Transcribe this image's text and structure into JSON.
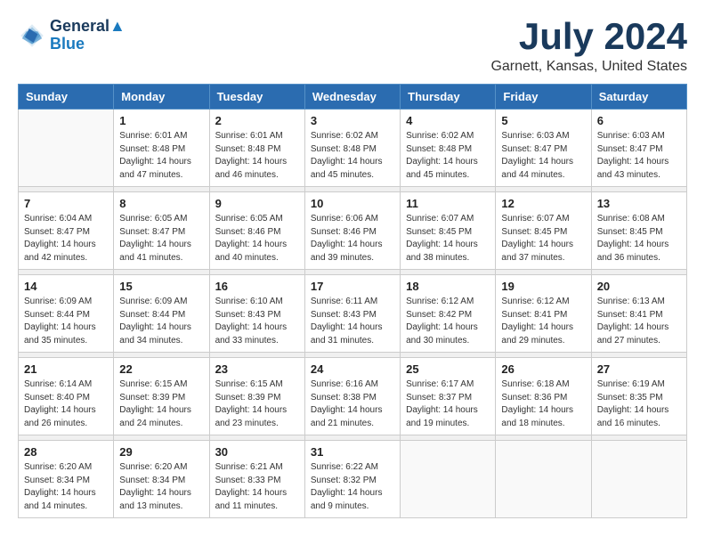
{
  "header": {
    "logo_line1": "General",
    "logo_line2": "Blue",
    "month": "July 2024",
    "location": "Garnett, Kansas, United States"
  },
  "weekdays": [
    "Sunday",
    "Monday",
    "Tuesday",
    "Wednesday",
    "Thursday",
    "Friday",
    "Saturday"
  ],
  "weeks": [
    [
      {
        "day": "",
        "empty": true
      },
      {
        "day": "1",
        "sunrise": "6:01 AM",
        "sunset": "8:48 PM",
        "daylight": "14 hours and 47 minutes."
      },
      {
        "day": "2",
        "sunrise": "6:01 AM",
        "sunset": "8:48 PM",
        "daylight": "14 hours and 46 minutes."
      },
      {
        "day": "3",
        "sunrise": "6:02 AM",
        "sunset": "8:48 PM",
        "daylight": "14 hours and 45 minutes."
      },
      {
        "day": "4",
        "sunrise": "6:02 AM",
        "sunset": "8:48 PM",
        "daylight": "14 hours and 45 minutes."
      },
      {
        "day": "5",
        "sunrise": "6:03 AM",
        "sunset": "8:47 PM",
        "daylight": "14 hours and 44 minutes."
      },
      {
        "day": "6",
        "sunrise": "6:03 AM",
        "sunset": "8:47 PM",
        "daylight": "14 hours and 43 minutes."
      }
    ],
    [
      {
        "day": "7",
        "sunrise": "6:04 AM",
        "sunset": "8:47 PM",
        "daylight": "14 hours and 42 minutes."
      },
      {
        "day": "8",
        "sunrise": "6:05 AM",
        "sunset": "8:47 PM",
        "daylight": "14 hours and 41 minutes."
      },
      {
        "day": "9",
        "sunrise": "6:05 AM",
        "sunset": "8:46 PM",
        "daylight": "14 hours and 40 minutes."
      },
      {
        "day": "10",
        "sunrise": "6:06 AM",
        "sunset": "8:46 PM",
        "daylight": "14 hours and 39 minutes."
      },
      {
        "day": "11",
        "sunrise": "6:07 AM",
        "sunset": "8:45 PM",
        "daylight": "14 hours and 38 minutes."
      },
      {
        "day": "12",
        "sunrise": "6:07 AM",
        "sunset": "8:45 PM",
        "daylight": "14 hours and 37 minutes."
      },
      {
        "day": "13",
        "sunrise": "6:08 AM",
        "sunset": "8:45 PM",
        "daylight": "14 hours and 36 minutes."
      }
    ],
    [
      {
        "day": "14",
        "sunrise": "6:09 AM",
        "sunset": "8:44 PM",
        "daylight": "14 hours and 35 minutes."
      },
      {
        "day": "15",
        "sunrise": "6:09 AM",
        "sunset": "8:44 PM",
        "daylight": "14 hours and 34 minutes."
      },
      {
        "day": "16",
        "sunrise": "6:10 AM",
        "sunset": "8:43 PM",
        "daylight": "14 hours and 33 minutes."
      },
      {
        "day": "17",
        "sunrise": "6:11 AM",
        "sunset": "8:43 PM",
        "daylight": "14 hours and 31 minutes."
      },
      {
        "day": "18",
        "sunrise": "6:12 AM",
        "sunset": "8:42 PM",
        "daylight": "14 hours and 30 minutes."
      },
      {
        "day": "19",
        "sunrise": "6:12 AM",
        "sunset": "8:41 PM",
        "daylight": "14 hours and 29 minutes."
      },
      {
        "day": "20",
        "sunrise": "6:13 AM",
        "sunset": "8:41 PM",
        "daylight": "14 hours and 27 minutes."
      }
    ],
    [
      {
        "day": "21",
        "sunrise": "6:14 AM",
        "sunset": "8:40 PM",
        "daylight": "14 hours and 26 minutes."
      },
      {
        "day": "22",
        "sunrise": "6:15 AM",
        "sunset": "8:39 PM",
        "daylight": "14 hours and 24 minutes."
      },
      {
        "day": "23",
        "sunrise": "6:15 AM",
        "sunset": "8:39 PM",
        "daylight": "14 hours and 23 minutes."
      },
      {
        "day": "24",
        "sunrise": "6:16 AM",
        "sunset": "8:38 PM",
        "daylight": "14 hours and 21 minutes."
      },
      {
        "day": "25",
        "sunrise": "6:17 AM",
        "sunset": "8:37 PM",
        "daylight": "14 hours and 19 minutes."
      },
      {
        "day": "26",
        "sunrise": "6:18 AM",
        "sunset": "8:36 PM",
        "daylight": "14 hours and 18 minutes."
      },
      {
        "day": "27",
        "sunrise": "6:19 AM",
        "sunset": "8:35 PM",
        "daylight": "14 hours and 16 minutes."
      }
    ],
    [
      {
        "day": "28",
        "sunrise": "6:20 AM",
        "sunset": "8:34 PM",
        "daylight": "14 hours and 14 minutes."
      },
      {
        "day": "29",
        "sunrise": "6:20 AM",
        "sunset": "8:34 PM",
        "daylight": "14 hours and 13 minutes."
      },
      {
        "day": "30",
        "sunrise": "6:21 AM",
        "sunset": "8:33 PM",
        "daylight": "14 hours and 11 minutes."
      },
      {
        "day": "31",
        "sunrise": "6:22 AM",
        "sunset": "8:32 PM",
        "daylight": "14 hours and 9 minutes."
      },
      {
        "day": "",
        "empty": true
      },
      {
        "day": "",
        "empty": true
      },
      {
        "day": "",
        "empty": true
      }
    ]
  ],
  "labels": {
    "sunrise_prefix": "Sunrise: ",
    "sunset_prefix": "Sunset: ",
    "daylight_prefix": "Daylight: "
  }
}
